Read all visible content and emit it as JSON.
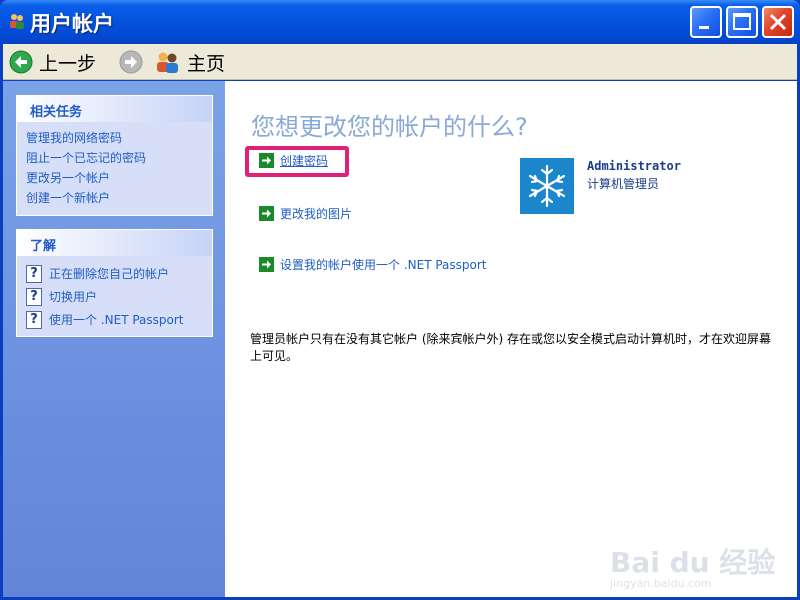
{
  "window": {
    "title": "用户帐户",
    "title_icon": "users-icon",
    "buttons": [
      "minimize-icon",
      "maximize-icon",
      "close-icon"
    ]
  },
  "toolbar": {
    "back_label": "上一步",
    "forward_icon": "forward-arrow-icon",
    "home_label": "主页"
  },
  "sidebar": {
    "related_tasks": {
      "header": "相关任务",
      "items": [
        "管理我的网络密码",
        "阻止一个已忘记的密码",
        "更改另一个帐户",
        "创建一个新帐户"
      ]
    },
    "learn": {
      "header": "了解",
      "items": [
        "正在删除您自己的帐户",
        "切换用户",
        "使用一个 .NET Passport"
      ]
    }
  },
  "main": {
    "title": "您想更改您的帐户的什么?",
    "actions": [
      "创建密码",
      "更改我的图片",
      "设置我的帐户使用一个 .NET Passport"
    ],
    "user": {
      "name": "Administrator",
      "role": "计算机管理员",
      "avatar_icon": "snowflake-icon"
    },
    "note": "管理员帐户只有在没有其它帐户 (除来宾帐户外) 存在或您以安全模式启动计算机时，才在欢迎屏幕上可见。"
  },
  "watermark": {
    "text": "Bai du 经验",
    "url": "jingyan.baidu.com"
  },
  "colors": {
    "titlebar": "#0452df",
    "sidebar_bg": "#6b90e0",
    "link": "#215dc6",
    "highlight": "#e0217a",
    "main_title": "#8aa8d8"
  }
}
